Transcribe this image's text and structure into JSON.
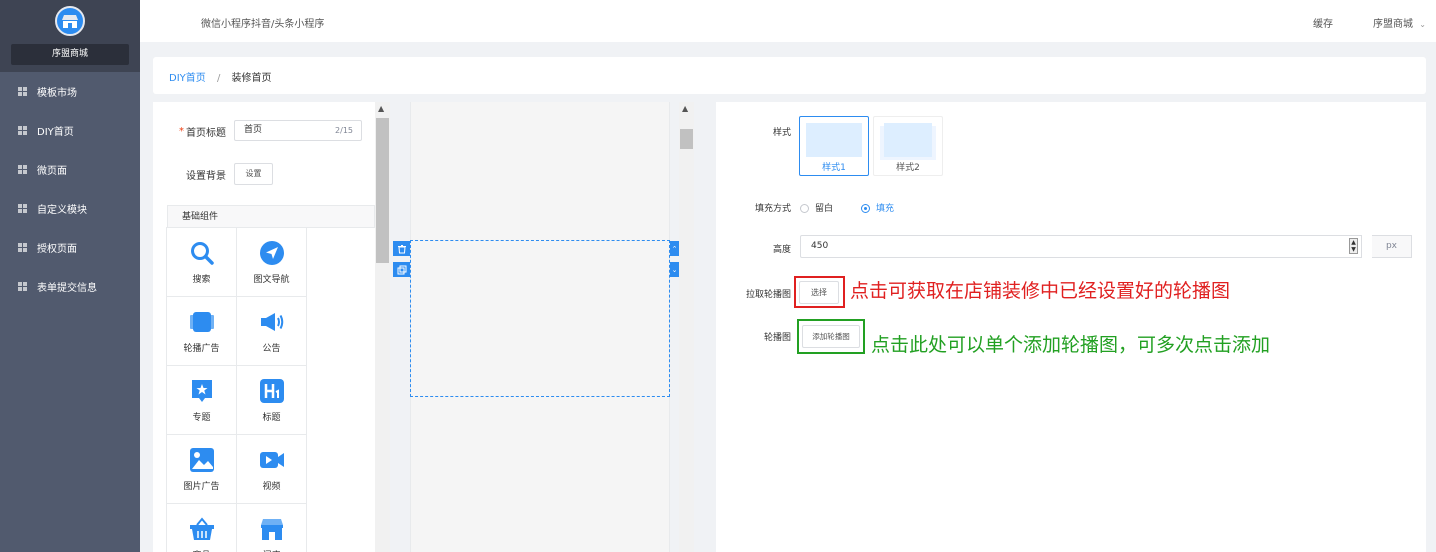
{
  "sidebar": {
    "shop_name": "序盟商城",
    "items": [
      {
        "label": "模板市场"
      },
      {
        "label": "DIY首页"
      },
      {
        "label": "微页面"
      },
      {
        "label": "自定义模块"
      },
      {
        "label": "授权页面"
      },
      {
        "label": "表单提交信息"
      }
    ]
  },
  "topbar": {
    "tabs": [
      "微信小程序",
      "抖音/头条小程序"
    ],
    "cache": "缓存",
    "user": "序盟商城"
  },
  "breadcrumb": {
    "root": "DIY首页",
    "separator": "/",
    "current": "装修首页"
  },
  "left": {
    "title_label": "首页标题",
    "title_value": "首页",
    "title_count": "2/15",
    "bg_label": "设置背景",
    "bg_button": "设置",
    "group": "基础组件",
    "components": [
      {
        "label": "搜索",
        "icon": "search-icon"
      },
      {
        "label": "图文导航",
        "icon": "navigation-icon"
      },
      {
        "label": "轮播广告",
        "icon": "carousel-icon"
      },
      {
        "label": "公告",
        "icon": "announcement-icon"
      },
      {
        "label": "专题",
        "icon": "topic-icon"
      },
      {
        "label": "标题",
        "icon": "heading-icon"
      },
      {
        "label": "图片广告",
        "icon": "image-ad-icon"
      },
      {
        "label": "视频",
        "icon": "video-icon"
      },
      {
        "label": "商品",
        "icon": "product-basket-icon"
      },
      {
        "label": "门店",
        "icon": "store-icon"
      }
    ]
  },
  "settings": {
    "style_label": "样式",
    "styles": [
      "样式1",
      "样式2"
    ],
    "fill_label": "填充方式",
    "fill_options": [
      "留白",
      "填充"
    ],
    "fill_selected": "填充",
    "height_label": "高度",
    "height_value": "450",
    "height_unit": "px",
    "fetch_label": "拉取轮播图",
    "fetch_button": "选择",
    "carousel_label": "轮播图",
    "add_button": "添加轮播图",
    "annotation_fetch": "点击可获取在店铺装修中已经设置好的轮播图",
    "annotation_add": "点击此处可以单个添加轮播图，可多次点击添加"
  },
  "colors": {
    "sidebar": "#515a6e",
    "accent": "#2d8cf0",
    "annotation_red": "#e02020",
    "annotation_green": "#22a022"
  }
}
